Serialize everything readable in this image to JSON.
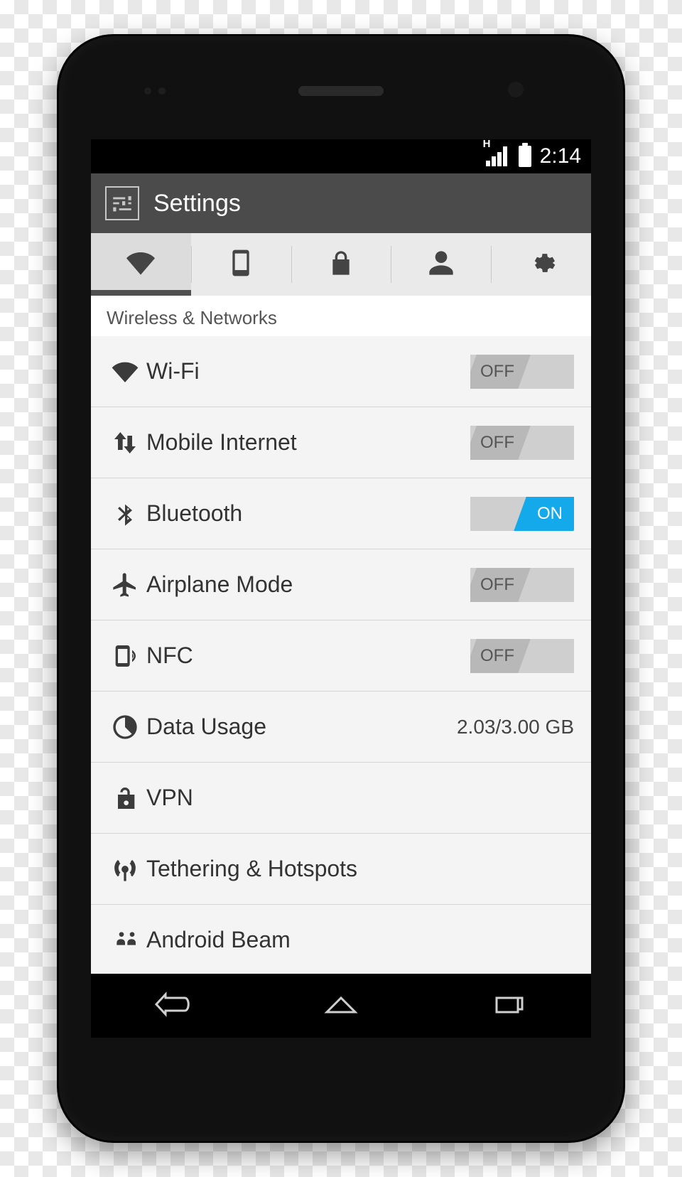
{
  "statusbar": {
    "network_type": "H",
    "time": "2:14"
  },
  "titlebar": {
    "title": "Settings"
  },
  "tabs": [
    {
      "name": "wifi",
      "active": true
    },
    {
      "name": "device",
      "active": false
    },
    {
      "name": "lock",
      "active": false
    },
    {
      "name": "person",
      "active": false
    },
    {
      "name": "system",
      "active": false
    }
  ],
  "section_title": "Wireless & Networks",
  "rows": {
    "wifi": {
      "label": "Wi-Fi",
      "toggle": "OFF"
    },
    "mobile": {
      "label": "Mobile Internet",
      "toggle": "OFF"
    },
    "bluetooth": {
      "label": "Bluetooth",
      "toggle": "ON"
    },
    "airplane": {
      "label": "Airplane Mode",
      "toggle": "OFF"
    },
    "nfc": {
      "label": "NFC",
      "toggle": "OFF"
    },
    "datausage": {
      "label": "Data Usage",
      "value": "2.03/3.00 GB"
    },
    "vpn": {
      "label": "VPN"
    },
    "tether": {
      "label": "Tethering & Hotspots"
    },
    "beam": {
      "label": "Android Beam"
    }
  }
}
